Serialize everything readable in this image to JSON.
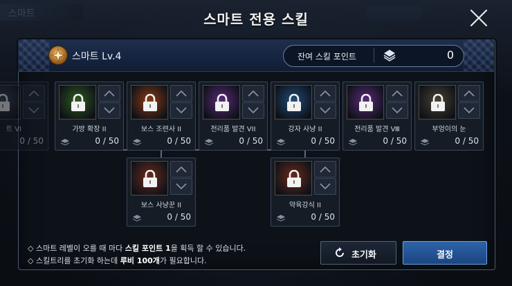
{
  "title": "스마트 전용 스킬",
  "hud": {
    "left_text": "스마트"
  },
  "class_name": "스마트 Lv.4",
  "points": {
    "label": "잔여 스킬 포인트",
    "value": "0"
  },
  "skills": [
    {
      "name": "트 VI",
      "points": "0 / 50",
      "tint": "#3a4658"
    },
    {
      "name": "가방 확장 II",
      "points": "0 / 50",
      "tint": "#2f5a1e"
    },
    {
      "name": "보스 조련사 II",
      "points": "0 / 50",
      "tint": "#8a3a16"
    },
    {
      "name": "전리품 발견 VII",
      "points": "0 / 50",
      "tint": "#5a2a78"
    },
    {
      "name": "강자 사냥 II",
      "points": "0 / 50",
      "tint": "#1f4c7a"
    },
    {
      "name": "전리품 발견 Ⅷ",
      "points": "0 / 50",
      "tint": "#5a2a78"
    },
    {
      "name": "부엉이의 눈",
      "points": "0 / 50",
      "tint": "#4a4232"
    },
    {
      "name": "보스 사냥꾼 II",
      "points": "0 / 50",
      "tint": "#6a2a1c"
    },
    {
      "name": "약육강식 II",
      "points": "0 / 50",
      "tint": "#6a2a1c"
    }
  ],
  "info": {
    "line1": {
      "a": "◇ 스마트 레벨이 오를 때 마다 ",
      "b": "스킬 포인트 1",
      "c": "을 획득 할 수 있습니다."
    },
    "line2": {
      "a": "◇ 스킬트리를 초기화 하는데 ",
      "b": "루비 100개",
      "c": "가 필요합니다."
    }
  },
  "buttons": {
    "reset": "초기화",
    "confirm": "결정"
  },
  "colors": {
    "accent": "#2d63a8",
    "panel_header": "#152440"
  }
}
